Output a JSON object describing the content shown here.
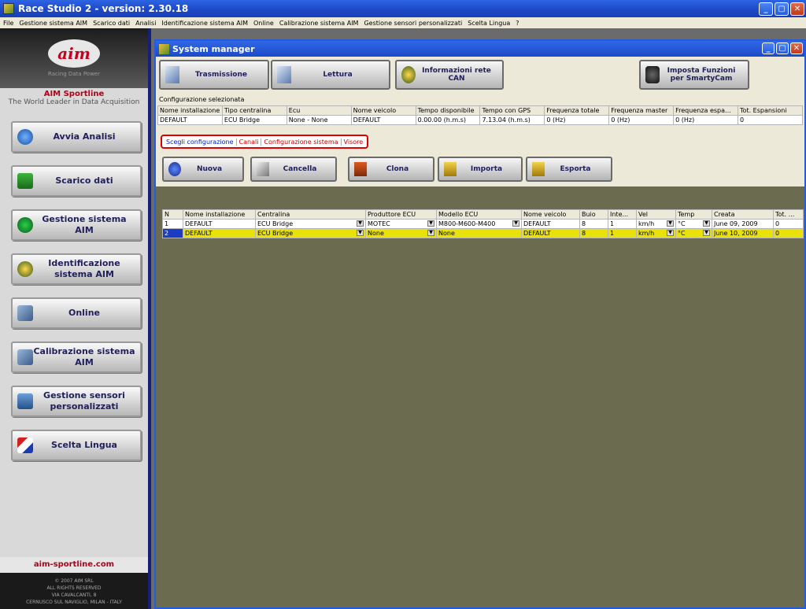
{
  "app": {
    "title": "Race Studio 2  - version: 2.30.18"
  },
  "menu": [
    "File",
    "Gestione sistema AIM",
    "Scarico dati",
    "Analisi",
    "Identificazione sistema AIM",
    "Online",
    "Calibrazione sistema AIM",
    "Gestione sensori personalizzati",
    "Scelta Lingua",
    "?"
  ],
  "sidebar": {
    "logo_text": "aim",
    "logo_tag": "Racing Data Power",
    "brand": "AIM Sportline",
    "tagline": "The World Leader in Data Acquisition",
    "items": [
      {
        "label": "Avvia Analisi",
        "icon": "globe-icon",
        "color": "#2a6dc9"
      },
      {
        "label": "Scarico dati",
        "icon": "download-icon",
        "color": "#2f9a2f"
      },
      {
        "label": "Gestione sistema AIM",
        "icon": "device-icon",
        "color": "#1d9a3a"
      },
      {
        "label": "Identificazione sistema AIM",
        "icon": "question-icon",
        "color": "#e0b000"
      },
      {
        "label": "Online",
        "icon": "computers-icon",
        "color": "#4a7ab0"
      },
      {
        "label": "Calibrazione sistema AIM",
        "icon": "calibration-icon",
        "color": "#4a7ab0"
      },
      {
        "label": "Gestione sensori personalizzati",
        "icon": "sensor-icon",
        "color": "#3a6aaa"
      },
      {
        "label": "Scelta Lingua",
        "icon": "flags-icon",
        "color": "#c02020"
      }
    ],
    "site": "aim-sportline.com",
    "footer1": "© 2007 AIM SRL",
    "footer2": "ALL RIGHTS RESERVED",
    "footer3": "VIA CAVALCANTI, 8",
    "footer4": "CERNUSCO SUL NAVIGLIO, MILAN - ITALY"
  },
  "sysmgr": {
    "title": "System manager",
    "toolbar": {
      "trasmissione": "Trasmissione",
      "lettura": "Lettura",
      "info_can": "Informazioni rete CAN",
      "smartycam": "Imposta Funzioni per SmartyCam"
    },
    "config_label": "Configurazione selezionata",
    "config_headers": [
      "Nome installazione",
      "Tipo centralina",
      "Ecu",
      "Nome veicolo",
      "Tempo disponibile",
      "Tempo con GPS",
      "Frequenza totale",
      "Frequenza master",
      "Frequenza espa...",
      "Tot. Espansioni"
    ],
    "config_row": [
      "DEFAULT",
      "ECU Bridge",
      "None - None",
      "DEFAULT",
      "0.00.00 (h.m.s)",
      "7.13.04 (h.m.s)",
      "0 (Hz)",
      "0 (Hz)",
      "0 (Hz)",
      "0"
    ],
    "tabs": [
      "Scegli configurazione",
      "Canali",
      "Configurazione sistema",
      "Visore"
    ],
    "actions": {
      "nuova": "Nuova",
      "cancella": "Cancella",
      "clona": "Clona",
      "importa": "Importa",
      "esporta": "Esporta"
    },
    "grid_headers": [
      "N",
      "Nome installazione",
      "Centralina",
      "Produttore ECU",
      "Modello ECU",
      "Nome veicolo",
      "Buio",
      "Inte...",
      "Vel",
      "Temp",
      "Creata",
      "Tot. ..."
    ],
    "grid_rows": [
      [
        "1",
        "DEFAULT",
        "ECU Bridge",
        "MOTEC",
        "M800-M600-M400",
        "DEFAULT",
        "8",
        "1",
        "km/h",
        "°C",
        "June 09, 2009",
        "0"
      ],
      [
        "2",
        "DEFAULT",
        "ECU Bridge",
        "None",
        "None",
        "DEFAULT",
        "8",
        "1",
        "km/h",
        "°C",
        "June 10, 2009",
        "0"
      ]
    ]
  }
}
